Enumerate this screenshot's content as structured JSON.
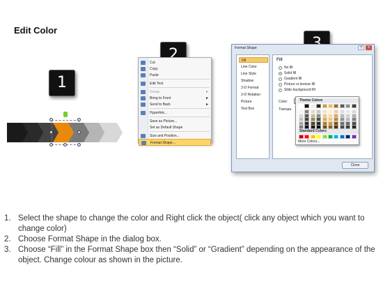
{
  "title": "Edit Color",
  "step_badges": [
    "1",
    "2",
    "3"
  ],
  "chevrons": [
    "#1a1a1a",
    "#2a2a2a",
    "#444444",
    "#e8890b",
    "#7a7a7a",
    "#b5b5b5",
    "#d8d8d8",
    "#ececec"
  ],
  "context_menu": {
    "items": [
      {
        "label": "Cut",
        "icon": "scissors-icon",
        "disabled": false,
        "submenu": false
      },
      {
        "label": "Copy",
        "icon": "copy-icon",
        "disabled": false,
        "submenu": false
      },
      {
        "label": "Paste",
        "icon": "paste-icon",
        "disabled": false,
        "submenu": false
      },
      {
        "label": "Edit Text",
        "icon": "edit-text-icon",
        "disabled": false,
        "submenu": false
      },
      {
        "label": "Group",
        "icon": "group-icon",
        "disabled": true,
        "submenu": true
      },
      {
        "label": "Bring to Front",
        "icon": "bring-front-icon",
        "disabled": false,
        "submenu": true
      },
      {
        "label": "Send to Back",
        "icon": "send-back-icon",
        "disabled": false,
        "submenu": true
      },
      {
        "label": "Hyperlink...",
        "icon": "hyperlink-icon",
        "disabled": false,
        "submenu": false
      },
      {
        "label": "Save as Picture...",
        "icon": "",
        "disabled": false,
        "submenu": false
      },
      {
        "label": "Set as Default Shape",
        "icon": "",
        "disabled": false,
        "submenu": false
      },
      {
        "label": "Size and Position...",
        "icon": "size-icon",
        "disabled": false,
        "submenu": false
      },
      {
        "label": "Format Shape...",
        "icon": "format-shape-icon",
        "disabled": false,
        "submenu": false,
        "highlighted": true
      }
    ]
  },
  "dialog": {
    "title": "Format Shape",
    "help": "?",
    "close_x": "x",
    "nav": [
      "Fill",
      "Line Color",
      "Line Style",
      "Shadow",
      "3-D Format",
      "3-D Rotation",
      "Picture",
      "Text Box"
    ],
    "panel_title": "Fill",
    "options": [
      "No fill",
      "Solid fill",
      "Gradient fill",
      "Picture or texture fill",
      "Slide background fill"
    ],
    "selected_option": "Solid fill",
    "color_label": "Color:",
    "transparency_label": "Transpa",
    "close_button": "Close"
  },
  "palette": {
    "theme_header": "Theme Colors",
    "standard_header": "Standard Colors",
    "more": "More Colors...",
    "theme_top": [
      "#ffffff",
      "#000000",
      "#eeece1",
      "#1f1f1f",
      "#c99a46",
      "#e8b86b",
      "#9c6b2e",
      "#5a5a5a",
      "#8c8c8c",
      "#3b3b3b"
    ],
    "theme_shades": [
      [
        "#f2f2f2",
        "#7f7f7f",
        "#ddd9c3",
        "#c6c6c6",
        "#f2e2c2",
        "#faecd3",
        "#e6cfae",
        "#dcdcdc",
        "#e8e8e8",
        "#d8d8d8"
      ],
      [
        "#d9d9d9",
        "#595959",
        "#c4bd97",
        "#8c8c8c",
        "#e8c98c",
        "#f5d9a8",
        "#d2ab74",
        "#b8b8b8",
        "#d0d0d0",
        "#b0b0b0"
      ],
      [
        "#bfbfbf",
        "#3f3f3f",
        "#938953",
        "#4d4d4d",
        "#d7ad59",
        "#efc67c",
        "#b8843e",
        "#939393",
        "#b8b8b8",
        "#7f7f7f"
      ],
      [
        "#a6a6a6",
        "#262626",
        "#494429",
        "#262626",
        "#a87a2a",
        "#c99a46",
        "#7a531f",
        "#6e6e6e",
        "#6a6a6a",
        "#4a4a4a"
      ],
      [
        "#7f7f7f",
        "#0c0c0c",
        "#1d1b10",
        "#0d0d0d",
        "#6f4f18",
        "#8a6628",
        "#4a3212",
        "#494949",
        "#404040",
        "#262626"
      ]
    ],
    "standard": [
      "#c00000",
      "#ff0000",
      "#ffc000",
      "#ffff00",
      "#92d050",
      "#00b050",
      "#00b0f0",
      "#0070c0",
      "#002060",
      "#7030a0"
    ]
  },
  "steps": [
    {
      "num": "1.",
      "text": "Select the shape to change the color and Right click the object( click any object which you want to change color)"
    },
    {
      "num": "2.",
      "text": "Choose Format Shape in the dialog box."
    },
    {
      "num": "3.",
      "text": "Choose “Fill” in the Format Shape box then “Solid” or “Gradient” depending on the appearance of the object. Change colour as shown in the picture."
    }
  ]
}
